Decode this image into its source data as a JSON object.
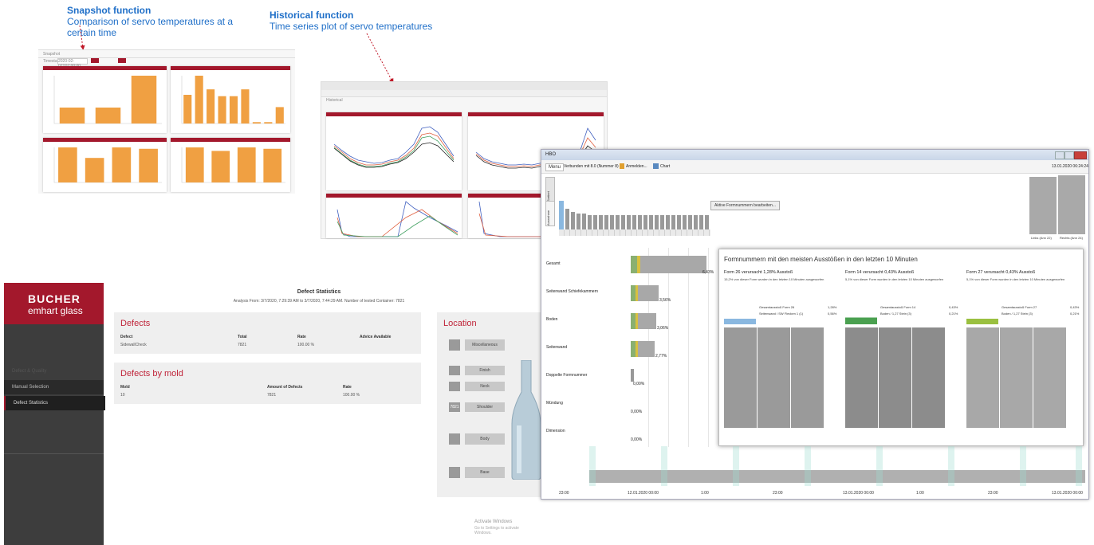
{
  "annotations": {
    "snapshot": {
      "title": "Snapshot function",
      "subtitle": "Comparison of servo temperatures at a certain time"
    },
    "historical": {
      "title": "Historical function",
      "subtitle": "Time series plot of servo temperatures"
    }
  },
  "colors": {
    "annotation_blue": "#1f6fc8",
    "bucher_red": "#a3182c",
    "bar_orange": "#f0a042"
  },
  "snapshot_app": {
    "breadcrumb": "Snapshot",
    "timestamp_label": "Timestamp",
    "timestamp_value": "2020-02-07T07:00:00",
    "chart_data": [
      {
        "type": "bar",
        "values": [
          20,
          20,
          60
        ]
      },
      {
        "type": "bar",
        "values": [
          42,
          70,
          50,
          40,
          40,
          50,
          2,
          2,
          24
        ]
      },
      {
        "type": "bar",
        "values": [
          50,
          35,
          50,
          48
        ]
      },
      {
        "type": "bar",
        "values": [
          50,
          45,
          50,
          48
        ]
      }
    ]
  },
  "historical_app": {
    "breadcrumb": "Historical"
  },
  "hbo_app": {
    "window_title": "HBO",
    "toolbar": {
      "menu": "Menu",
      "connection": "Verbunden mit 8.0 (Nummer 8)",
      "login": "Anmelden...",
      "chart": "Chart"
    },
    "timestamp": "13.01.2020 06:24:24",
    "active_molds_button": "Aktive Formnummern bearbeiten...",
    "side_tabs": [
      "Sortiert",
      "Ausnahme"
    ],
    "categories": [
      {
        "label": "Gesamt",
        "pct": "6,43%"
      },
      {
        "label": "Seitenwand Schiefekammern",
        "pct": "3,56%"
      },
      {
        "label": "Boden",
        "pct": "3,06%"
      },
      {
        "label": "Seitenwand",
        "pct": "2,77%"
      },
      {
        "label": "Doppelte Formnummer",
        "pct": "0,00%"
      },
      {
        "label": "Mündung",
        "pct": "0,00%"
      },
      {
        "label": "Dimension",
        "pct": "0,00%"
      }
    ],
    "popup_title": "Formnummern mit den meisten Ausstößen in den letzten 10 Minuten",
    "top_forms": [
      {
        "title": "Form 26 verursacht 1,28% Ausstoß",
        "note": "15,2% von dieser Form wurden in den letzten 10 Minuten ausgeworfen",
        "legend1": "Gesamtausstoß Form 26",
        "legend1_val": "1,28%",
        "legend2": "Seitenwand / SW Flecken 1 (1)",
        "legend2_val": "0,56%",
        "color": "#4a8ee0"
      },
      {
        "title": "Form 14 verursacht 0,43% Ausstoß",
        "note": "5,1% von dieser Form wurden in den letzten 10 Minuten ausgeworfen",
        "legend1": "Gesamtausstoß Form 14",
        "legend1_val": "0,43%",
        "legend2": "Boden / 1,27 Stein (3)",
        "legend2_val": "0,21%",
        "color": "#3aa040"
      },
      {
        "title": "Form 27 verursacht 0,43% Ausstoß",
        "note": "5,1% von dieser Form wurden in den letzten 10 Minuten ausgeworfen",
        "legend1": "Gesamtausstoß Form 27",
        "legend1_val": "0,43%",
        "legend2": "Boden / 1,27 Stein (3)",
        "legend2_val": "0,21%",
        "color": "#8ab830"
      }
    ],
    "right_labels": [
      "Links (Ann 22)",
      "Rechts (Ann 24)"
    ],
    "time_ticks": [
      "23:00",
      "12.01.2020 00:00",
      "1:00",
      "23:00",
      "13.01.2020 00:00",
      "1:00",
      "23:00",
      "13.01.2020 00:00"
    ]
  },
  "bucher_app": {
    "brand_line1": "BUCHER",
    "brand_line2": "emhart glass",
    "menu": [
      "Manual Selection",
      "Defect Statistics"
    ],
    "menu_group": "Defect & Quality",
    "page_title": "Defect Statistics",
    "analysis": "Analysis From: 3/7/2020, 7:29:39 AM to 3/7/2020, 7:44:29 AM. Number of tested Container: 7821",
    "defects": {
      "title": "Defects",
      "headers": [
        "Defect",
        "Total",
        "Rate",
        "Advice Available"
      ],
      "row": [
        "SidewallCheck",
        "7821",
        "100.00 %",
        ""
      ]
    },
    "defects_by_mold": {
      "title": "Defects by mold",
      "headers": [
        "Mold",
        "Amount of Defects",
        "Rate"
      ],
      "row": [
        "10",
        "7821",
        "100.00 %"
      ]
    },
    "location": {
      "title": "Location",
      "items": [
        {
          "label": "Miscellaneous",
          "count": ""
        },
        {
          "label": "Finish",
          "count": ""
        },
        {
          "label": "Neck",
          "count": ""
        },
        {
          "label": "Shoulder",
          "count": "7821"
        },
        {
          "label": "Body",
          "count": ""
        },
        {
          "label": "Base",
          "count": ""
        }
      ]
    },
    "watermark_line1": "Activate Windows",
    "watermark_line2": "Go to Settings to activate Windows."
  }
}
